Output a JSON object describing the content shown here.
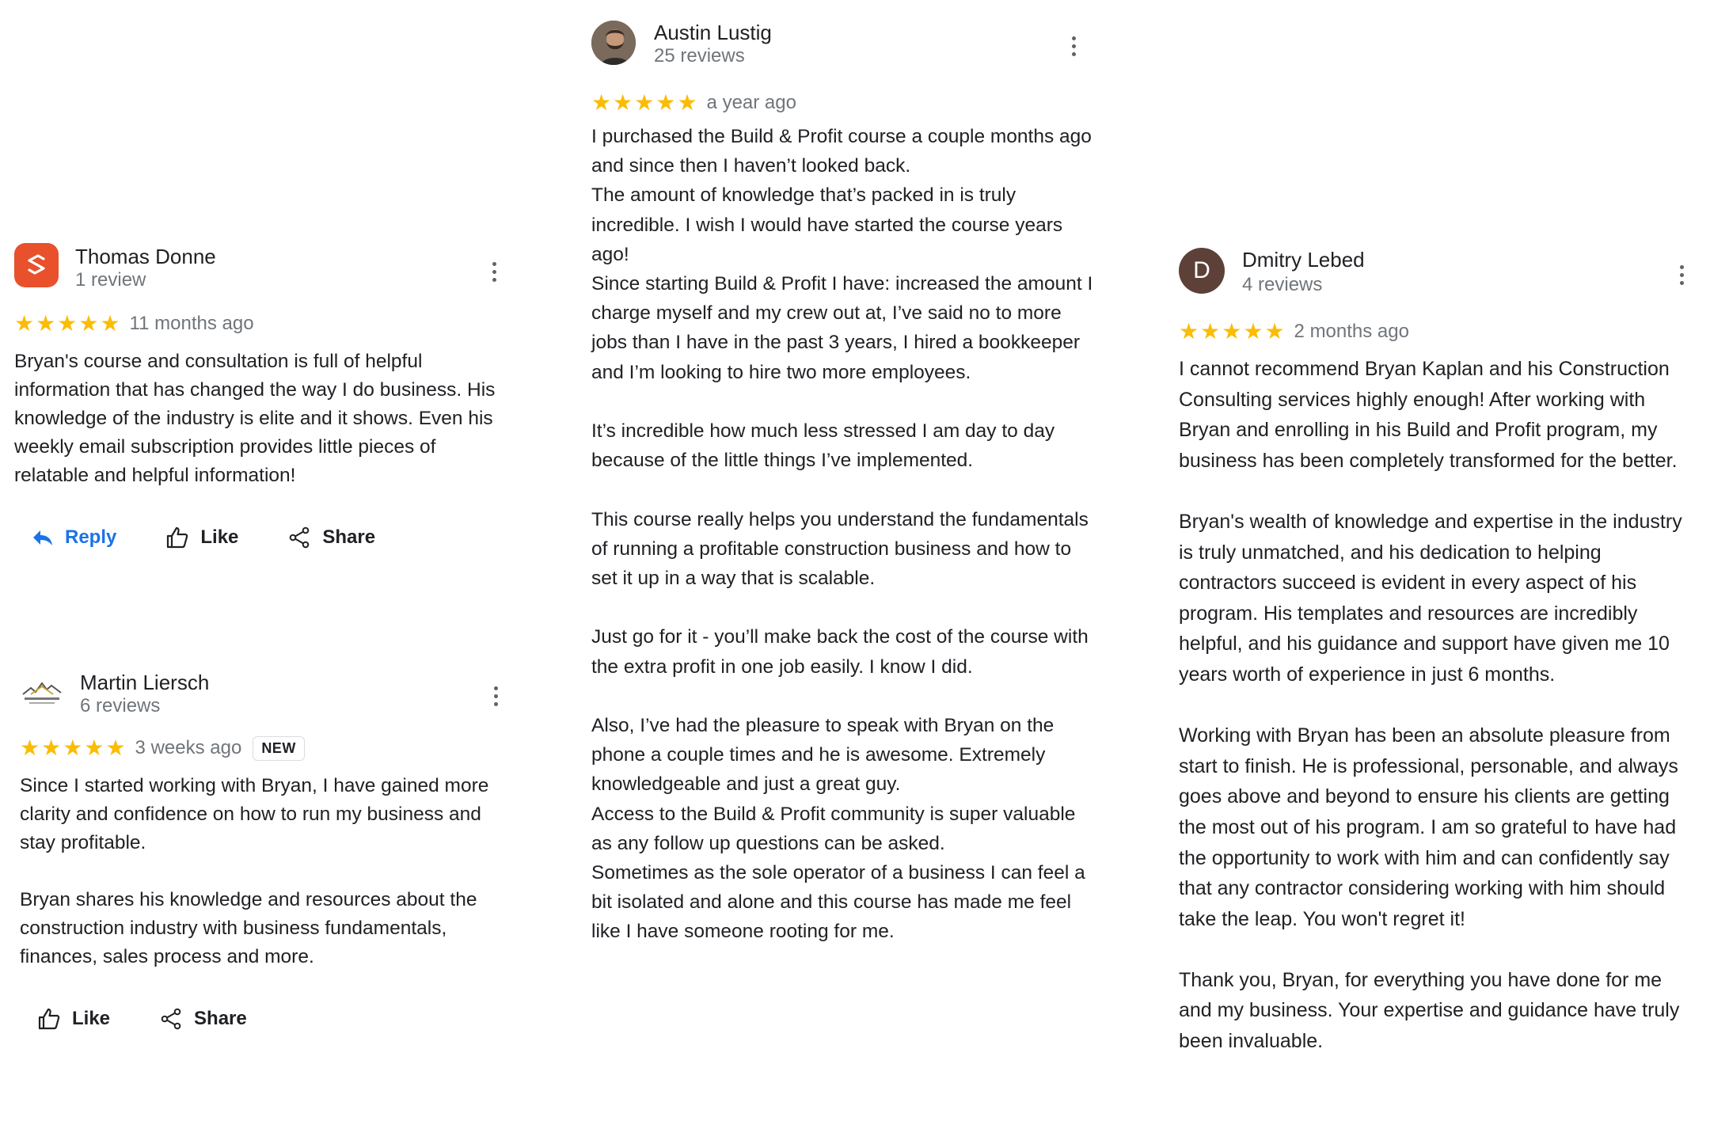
{
  "reviews": {
    "thomas": {
      "author": "Thomas Donne",
      "count": "1 review",
      "time": "11 months ago",
      "rating": 5,
      "paragraphs": [
        "Bryan's course and consultation is full of helpful information that has changed the way I do business.  His knowledge of the industry is elite and it shows.  Even his weekly email subscription provides little pieces of relatable  and helpful information!"
      ],
      "actions": {
        "reply": "Reply",
        "like": "Like",
        "share": "Share"
      }
    },
    "martin": {
      "author": "Martin Liersch",
      "count": "6 reviews",
      "time": "3 weeks ago",
      "badge": "NEW",
      "rating": 5,
      "paragraphs": [
        "Since I started working with Bryan, I have gained more clarity and confidence on how to run my business and stay profitable.",
        "Bryan shares his knowledge and resources about the construction industry with business fundamentals, finances, sales process and more."
      ],
      "actions": {
        "like": "Like",
        "share": "Share"
      }
    },
    "austin": {
      "author": "Austin Lustig",
      "count": "25 reviews",
      "time": "a year ago",
      "rating": 5,
      "paragraphs": [
        "I purchased the Build & Profit course a couple months ago and since then I haven’t looked back.",
        "The amount of knowledge that’s packed in is truly incredible. I wish I would have started the course years ago!",
        "Since starting Build & Profit I have: increased the amount I charge myself and my crew out at, I’ve said no to more jobs than I have in the past 3 years, I hired a bookkeeper and I’m looking to hire two more employees.",
        "It’s incredible how much less stressed I am day to day because of the little things I’ve implemented.",
        "This course really helps you understand the fundamentals of running a profitable construction business and how to set it up in a way that is scalable.",
        "Just go for it -  you’ll make back the cost of the course with the extra profit in one job easily. I know I did.",
        "Also, I’ve had the pleasure to speak with Bryan on the phone a couple times and he is awesome. Extremely knowledgeable and just a great guy.",
        "Access to the Build & Profit community is super valuable as any follow up questions can be asked.",
        "Sometimes as the sole operator of a business I can feel a bit isolated and alone and this course has made me feel like I have someone rooting for me."
      ]
    },
    "dmitry": {
      "author": "Dmitry Lebed",
      "count": "4 reviews",
      "initial": "D",
      "time": "2 months ago",
      "rating": 5,
      "paragraphs": [
        "I cannot recommend Bryan Kaplan and his Construction Consulting services highly enough! After working with Bryan and enrolling in his Build and Profit program, my business has been completely transformed for the better.",
        "Bryan's wealth of knowledge and expertise in the industry is truly unmatched, and his dedication to helping contractors succeed is evident in every aspect of his program. His templates and resources are incredibly helpful, and his guidance and support have given me 10 years worth of experience in just 6 months.",
        "Working with Bryan has been an absolute pleasure from start to finish. He is professional, personable, and always goes above and beyond to ensure his clients are getting the most out of his program. I am so grateful to have had the opportunity to work with him and can confidently say that any contractor considering working with him should take the leap. You won't regret it!",
        "Thank you, Bryan, for everything you have done for me and my business. Your expertise and guidance have truly been invaluable."
      ]
    }
  },
  "colors": {
    "star": "#fbbc04",
    "reply_blue": "#1a73e8",
    "muted": "#70757a",
    "text": "#202124",
    "thomas_avatar": "#e8512c",
    "dmitry_avatar": "#5d4037"
  },
  "icons": [
    "kebab-menu-icon",
    "star-icon",
    "reply-arrow-icon",
    "thumbs-up-icon",
    "share-icon"
  ]
}
